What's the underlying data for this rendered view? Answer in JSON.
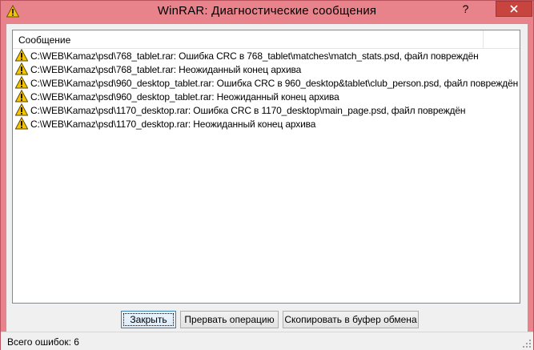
{
  "window": {
    "title": "WinRAR: Диагностические сообщения",
    "accent_color": "#e8838c",
    "close_button_color": "#c7443f"
  },
  "list": {
    "column_header": "Сообщение",
    "rows": [
      {
        "icon": "warning-icon",
        "text": "C:\\WEB\\Kamaz\\psd\\768_tablet.rar: Ошибка CRC в 768_tablet\\matches\\match_stats.psd, файл повреждён"
      },
      {
        "icon": "warning-icon",
        "text": "C:\\WEB\\Kamaz\\psd\\768_tablet.rar: Неожиданный конец архива"
      },
      {
        "icon": "warning-icon",
        "text": "C:\\WEB\\Kamaz\\psd\\960_desktop_tablet.rar: Ошибка CRC в 960_desktop&tablet\\club_person.psd, файл повреждён"
      },
      {
        "icon": "warning-icon",
        "text": "C:\\WEB\\Kamaz\\psd\\960_desktop_tablet.rar: Неожиданный конец архива"
      },
      {
        "icon": "warning-icon",
        "text": "C:\\WEB\\Kamaz\\psd\\1170_desktop.rar: Ошибка CRC в 1170_desktop\\main_page.psd, файл повреждён"
      },
      {
        "icon": "warning-icon",
        "text": "C:\\WEB\\Kamaz\\psd\\1170_desktop.rar: Неожиданный конец архива"
      }
    ]
  },
  "buttons": {
    "close_label": "Закрыть",
    "abort_label": "Прервать операцию",
    "copy_label": "Скопировать в буфер обмена"
  },
  "status": {
    "errors_text": "Всего ошибок: 6"
  }
}
